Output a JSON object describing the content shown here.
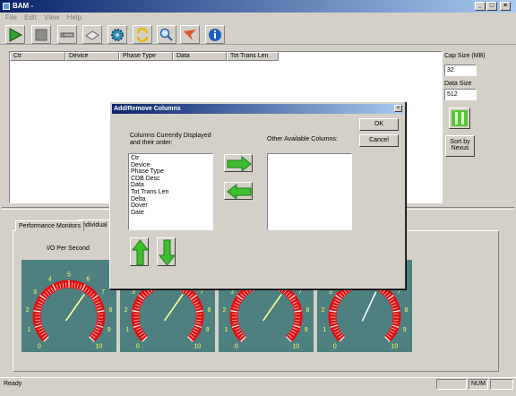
{
  "window": {
    "title": "BAM -"
  },
  "menu": [
    "File",
    "Edit",
    "View",
    "Help"
  ],
  "toolbar": {
    "buttons": [
      {
        "name": "play-icon"
      },
      {
        "name": "stop-icon"
      },
      {
        "name": "probe-icon"
      },
      {
        "name": "disk-icon"
      },
      {
        "name": "gear-icon"
      },
      {
        "name": "refresh-icon"
      },
      {
        "name": "search-icon"
      },
      {
        "name": "flag-icon"
      },
      {
        "name": "info-icon"
      }
    ]
  },
  "list": {
    "columns": [
      "Ctr",
      "Device",
      "Phase Type",
      "Data",
      "Tot Trans Len"
    ]
  },
  "side": {
    "cap_size_label": "Cap Size (MB)",
    "cap_size_value": "32",
    "data_size_label": "Data Size",
    "data_size_value": "512",
    "sort_label_1": "Sort by",
    "sort_label_2": "Nexus"
  },
  "tabs": [
    "Performance Monitors",
    "Individual I/"
  ],
  "gauges": {
    "first_title": "I/O Per Second",
    "scale_labels": [
      "0",
      "1",
      "2",
      "3",
      "4",
      "5",
      "6",
      "7",
      "8",
      "9",
      "10"
    ]
  },
  "status": {
    "text": "Ready",
    "num": "NUM"
  },
  "dialog": {
    "title": "Add/Remove Columns",
    "displayed_label_1": "Columns Currently Displayed",
    "displayed_label_2": "and their order:",
    "available_label": "Other Available Columns:",
    "displayed_columns": [
      "Ctr",
      "Device",
      "Phase Type",
      "CDB Desc",
      "Data",
      "Tot Trans Len",
      "Delta",
      "Dover",
      "Date"
    ],
    "ok_label": "OK",
    "cancel_label": "Cancel"
  },
  "colors": {
    "title_bar": "#0a246a",
    "gauge_bg": "#4e8081",
    "gauge_ring": "#e01010",
    "gauge_text": "#ffff60",
    "arrow_green": "#3fbf2f"
  }
}
